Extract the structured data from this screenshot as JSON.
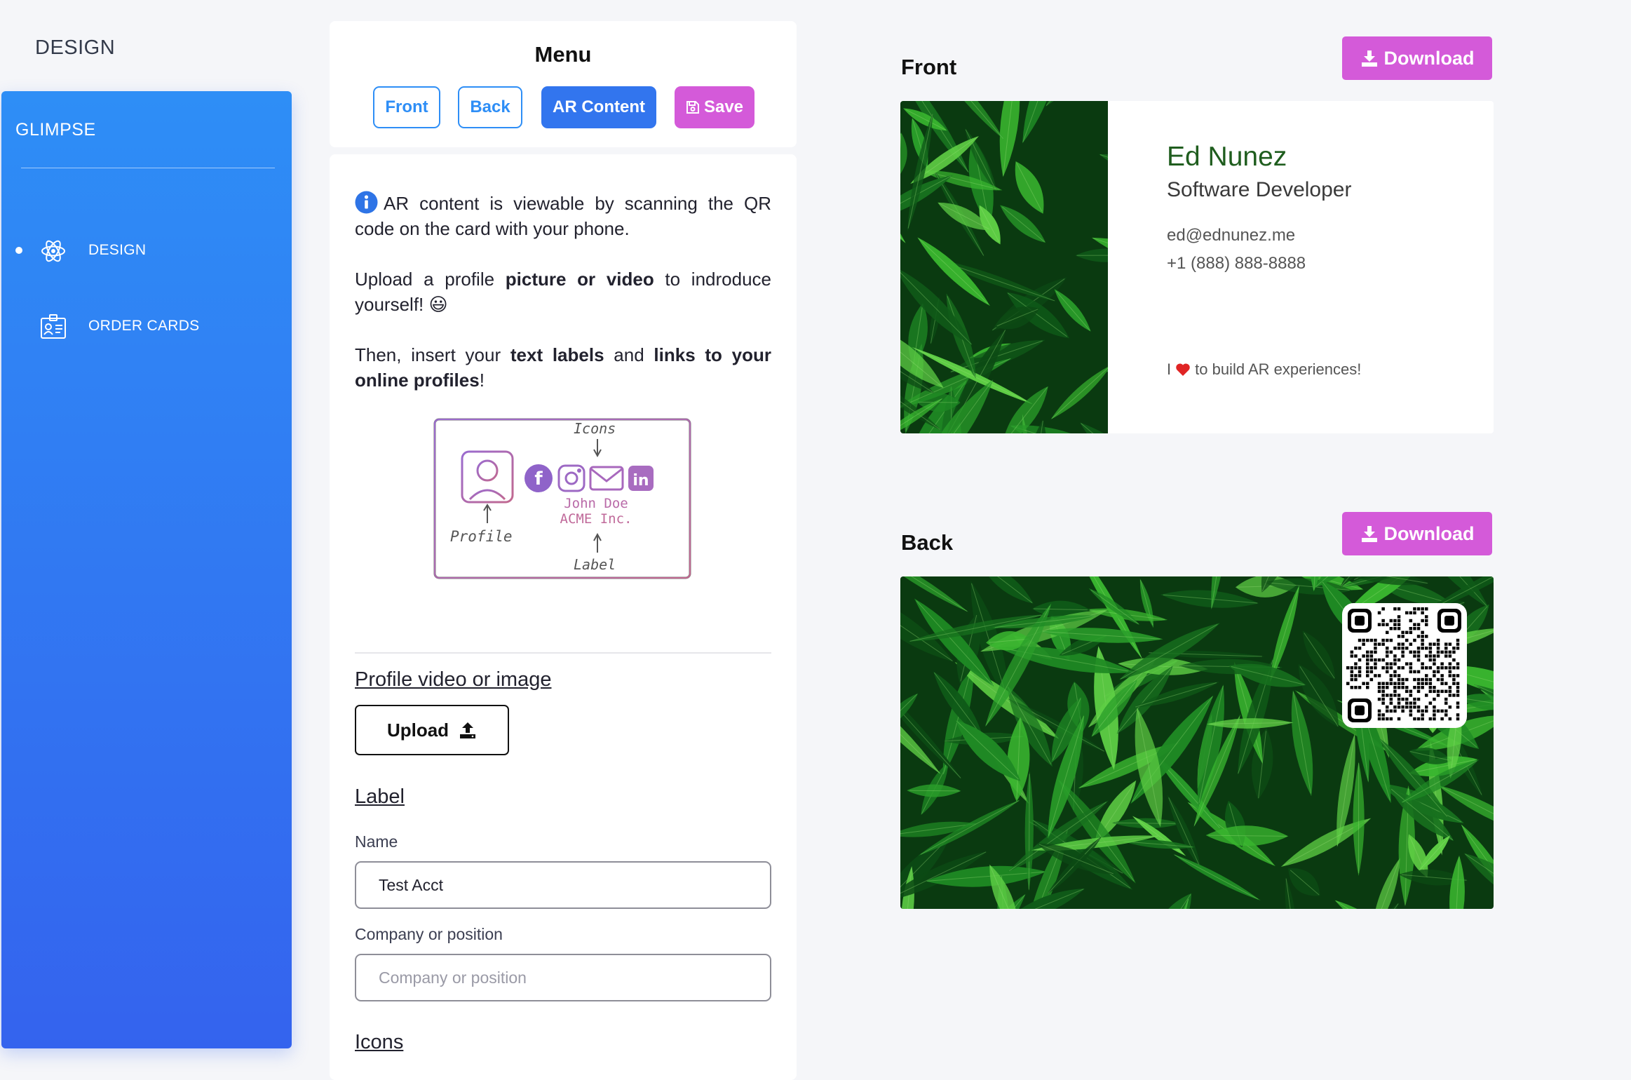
{
  "app": {
    "page_title": "DESIGN"
  },
  "sidebar": {
    "brand": "GLIMPSE",
    "items": [
      {
        "label": "DESIGN",
        "icon": "atom-icon",
        "active": true
      },
      {
        "label": "ORDER CARDS",
        "icon": "id-card-icon",
        "active": false
      }
    ]
  },
  "menu": {
    "title": "Menu",
    "buttons": {
      "front": "Front",
      "back": "Back",
      "ar_content": "AR Content",
      "save": "Save"
    }
  },
  "content": {
    "intro": {
      "info": "AR content is viewable by scanning the QR code on the card with your phone.",
      "upload_pre": "Upload a profile ",
      "upload_bold": "picture or video",
      "upload_post": " to indroduce yourself! 😃",
      "insert_pre": "Then, insert your ",
      "insert_bold1": "text labels",
      "insert_mid": " and ",
      "insert_bold2": "links to your online profiles",
      "insert_post": "!"
    },
    "diagram": {
      "icons_label": "Icons",
      "profile_label": "Profile",
      "label_label": "Label",
      "sample_name": "John Doe",
      "sample_company": "ACME Inc."
    },
    "profile_section": {
      "title": "Profile video or image",
      "upload_label": "Upload"
    },
    "label_section": {
      "title": "Label",
      "name_label": "Name",
      "name_value": "Test Acct",
      "company_label": "Company or position",
      "company_placeholder": "Company or position"
    },
    "icons_section": {
      "title": "Icons"
    }
  },
  "preview": {
    "download_label": "Download",
    "front": {
      "title": "Front",
      "name": "Ed Nunez",
      "role": "Software Developer",
      "email": "ed@ednunez.me",
      "phone": "+1 (888) 888-8888",
      "tagline_pre": "I",
      "tagline_post": "to build AR experiences!"
    },
    "back": {
      "title": "Back"
    }
  },
  "colors": {
    "sidebar_top": "#2e8ef6",
    "sidebar_bottom": "#3463ee",
    "primary": "#3275ee",
    "accent": "#d45ad9",
    "card_name": "#1f5d1e",
    "leaf_dark": "#0a3a10",
    "leaf_light": "#39b52f"
  }
}
